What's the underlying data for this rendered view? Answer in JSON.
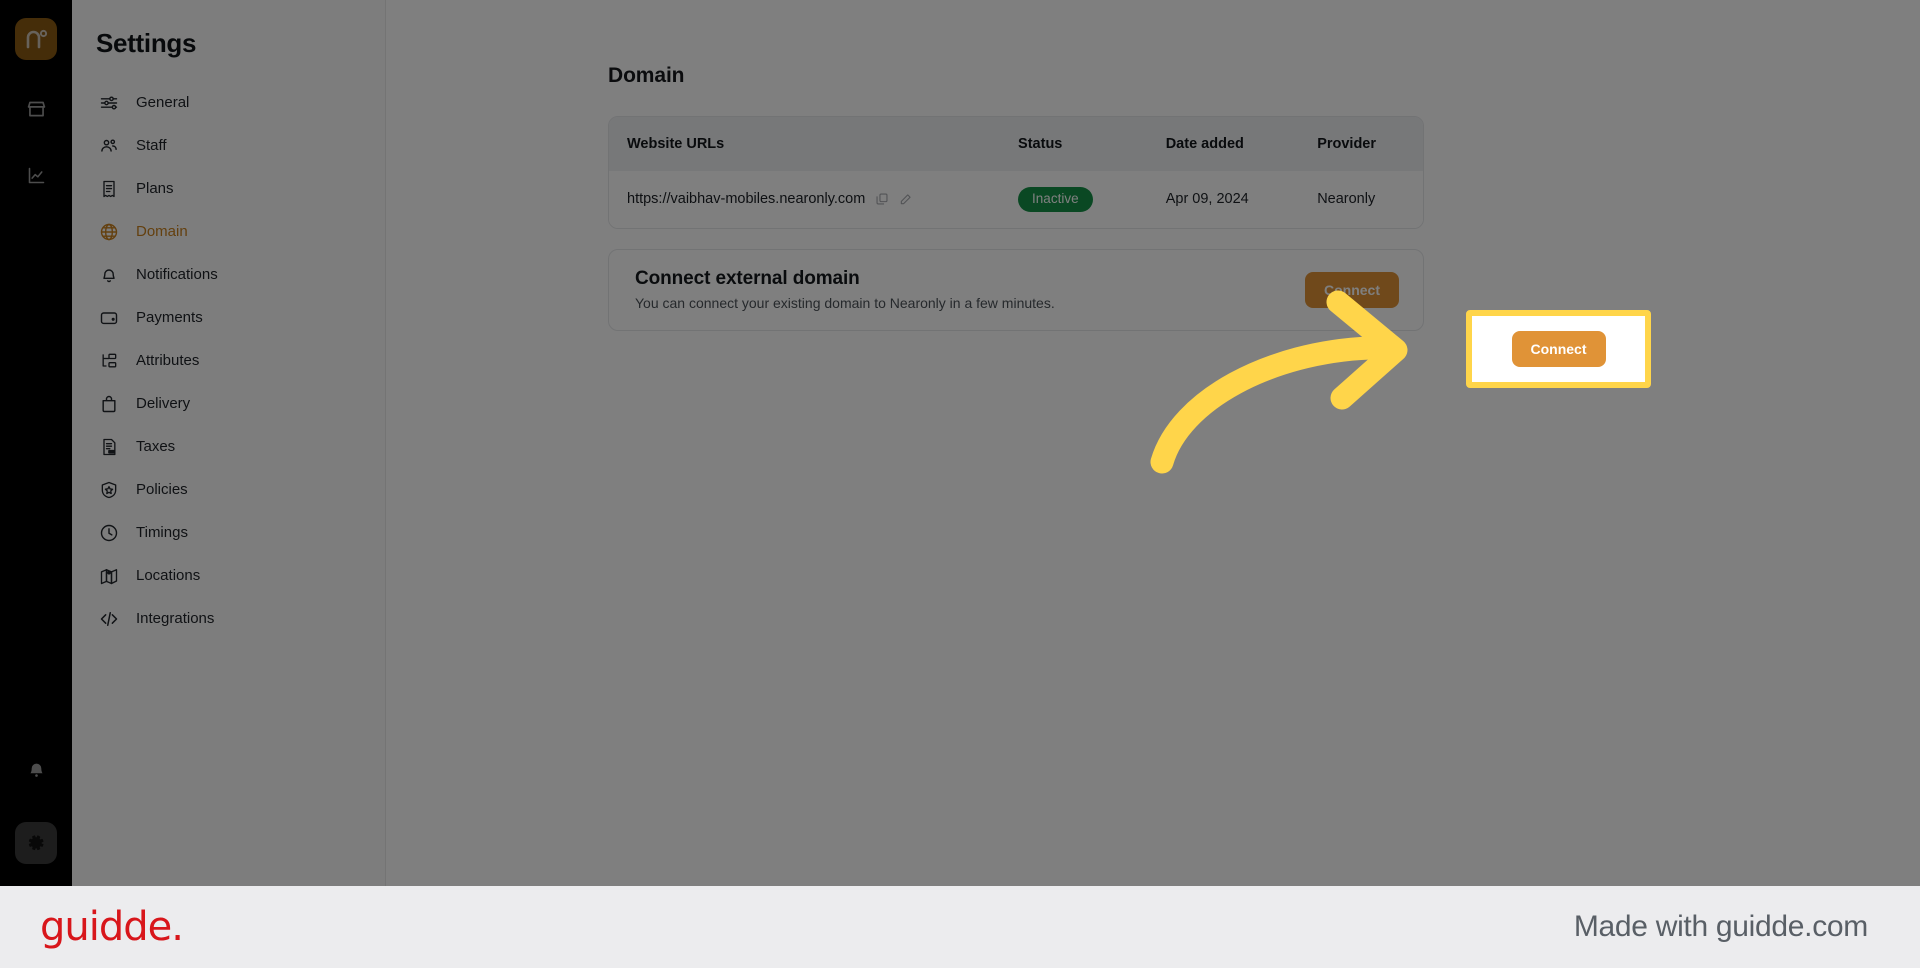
{
  "rail": {
    "logo_alt": "nearonly-logo",
    "icons": [
      {
        "name": "store-icon",
        "label": "Store"
      },
      {
        "name": "analytics-icon",
        "label": "Analytics"
      }
    ],
    "bottom_icons": [
      {
        "name": "bell-icon",
        "label": "Notifications"
      },
      {
        "name": "gear-icon",
        "label": "Settings"
      }
    ]
  },
  "sidebar": {
    "title": "Settings",
    "items": [
      {
        "label": "General",
        "icon": "sliders-icon",
        "active": false
      },
      {
        "label": "Staff",
        "icon": "users-icon",
        "active": false
      },
      {
        "label": "Plans",
        "icon": "receipt-icon",
        "active": false
      },
      {
        "label": "Domain",
        "icon": "globe-icon",
        "active": true
      },
      {
        "label": "Notifications",
        "icon": "bell-icon",
        "active": false
      },
      {
        "label": "Payments",
        "icon": "wallet-icon",
        "active": false
      },
      {
        "label": "Attributes",
        "icon": "sitemap-icon",
        "active": false
      },
      {
        "label": "Delivery",
        "icon": "bag-icon",
        "active": false
      },
      {
        "label": "Taxes",
        "icon": "tax-doc-icon",
        "active": false
      },
      {
        "label": "Policies",
        "icon": "shield-icon",
        "active": false
      },
      {
        "label": "Timings",
        "icon": "clock-icon",
        "active": false
      },
      {
        "label": "Locations",
        "icon": "map-icon",
        "active": false
      },
      {
        "label": "Integrations",
        "icon": "code-icon",
        "active": false
      }
    ]
  },
  "main": {
    "page_title": "Domain",
    "table": {
      "columns": [
        "Website URLs",
        "Status",
        "Date added",
        "Provider"
      ],
      "rows": [
        {
          "url": "https://vaibhav-mobiles.nearonly.com",
          "status": "Inactive",
          "status_color": "#149146",
          "date_added": "Apr 09, 2024",
          "provider": "Nearonly",
          "row_actions": [
            "copy-icon",
            "edit-icon"
          ]
        }
      ]
    },
    "connect_card": {
      "title": "Connect external domain",
      "subtitle": "You can connect your existing domain to Nearonly in a few minutes.",
      "button_label": "Connect",
      "button_color": "#e09337"
    }
  },
  "annotation": {
    "highlight_color": "#ffd54a",
    "arrow_color": "#ffd54a",
    "target": "Connect"
  },
  "footer": {
    "logo_text": "guidde.",
    "logo_color": "#d8161b",
    "made_with": "Made with guidde.com"
  }
}
